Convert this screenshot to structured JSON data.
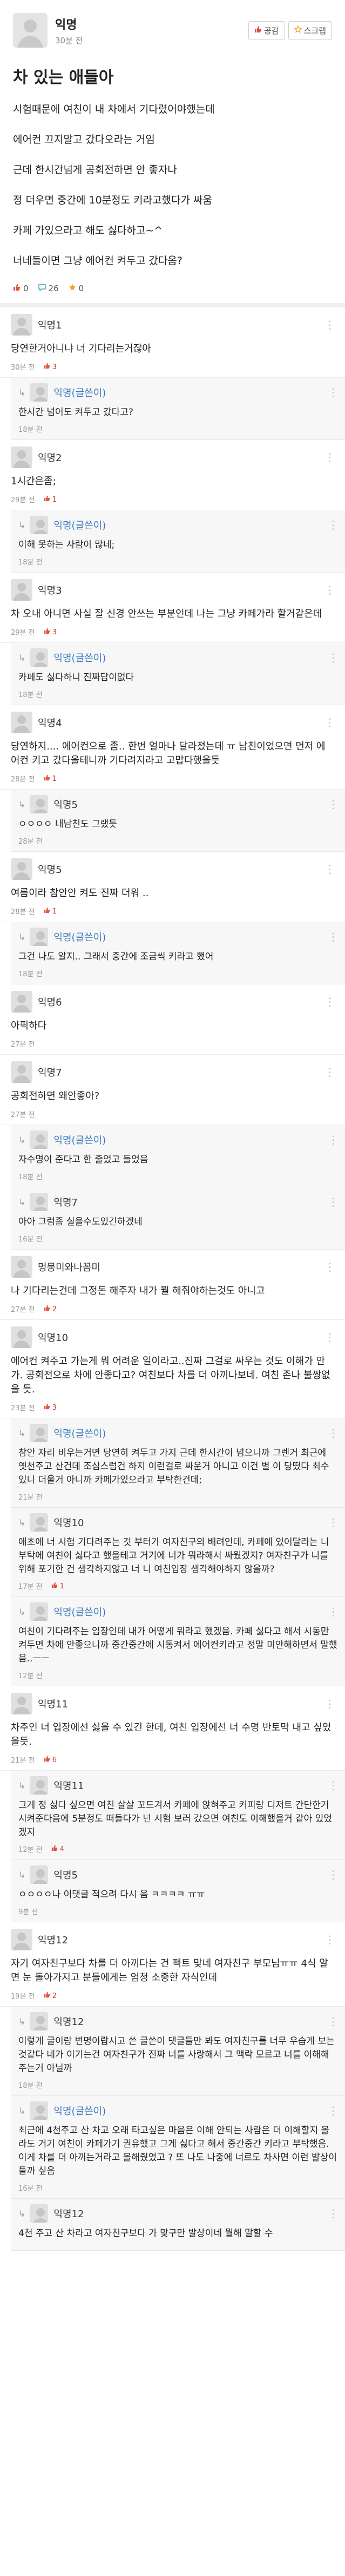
{
  "post": {
    "author": "익명",
    "time": "30분 전",
    "like_label": "공감",
    "scrap_label": "스크랩",
    "title": "차 있는 애들아",
    "paragraphs": [
      "시험때문에 여친이 내 차에서 기다렸어야했는데",
      "에어컨 끄지말고 갔다오라는 거임",
      "근데 한시간넘게 공회전하면 안 좋자나",
      "정 더우면 중간에 10분정도 키라고했다가 싸움",
      "카페 가있으라고 해도 싫다하고~^",
      "너네들이면 그냥 에어컨 켜두고 갔다옴?"
    ],
    "likes": "0",
    "comments": "26",
    "scraps": "0"
  },
  "comments": [
    {
      "type": "comment",
      "name": "익명1",
      "text": "당연한거아니냐 너 기다리는거잖아",
      "time": "30분 전",
      "likes": "3"
    },
    {
      "type": "reply",
      "name": "익명(글쓴이)",
      "text": "한시간 넘어도 켜두고 갔다고?",
      "time": "18분 전",
      "likes": ""
    },
    {
      "type": "comment",
      "name": "익명2",
      "text": "1시간은좀;",
      "time": "29분 전",
      "likes": "1"
    },
    {
      "type": "reply",
      "name": "익명(글쓴이)",
      "text": "이해 못하는 사람이 많네;",
      "time": "18분 전",
      "likes": ""
    },
    {
      "type": "comment",
      "name": "익명3",
      "text": "차 오내 아니면 사실 잘 신경 안쓰는 부분인데 나는 그냥 카페가라 할거같은데",
      "time": "29분 전",
      "likes": "3"
    },
    {
      "type": "reply",
      "name": "익명(글쓴이)",
      "text": "카페도 싫다하니 진짜답이없다",
      "time": "18분 전",
      "likes": ""
    },
    {
      "type": "comment",
      "name": "익명4",
      "text": "당연하지.... 에어컨으로 좀.. 한번 얼마나 달라졌는데 ㅠ 남친이었으면 먼저 에어컨 키고 갔다올테니까 기다려지라고 고맙다했을듯",
      "time": "28분 전",
      "likes": "1"
    },
    {
      "type": "reply",
      "name": "익명5",
      "text": "ㅇㅇㅇㅇ 내남친도 그랬듯",
      "time": "28분 전",
      "likes": ""
    },
    {
      "type": "comment",
      "name": "익명5",
      "text": "여름이라 참안안 켜도 진짜 더워 ..",
      "time": "28분 전",
      "likes": "1"
    },
    {
      "type": "reply",
      "name": "익명(글쓴이)",
      "text": "그건 나도 알지.. 그래서 중간에 조금씩 키라고 했어",
      "time": "18분 전",
      "likes": ""
    },
    {
      "type": "comment",
      "name": "익명6",
      "text": "아픽하다",
      "time": "27분 전",
      "likes": ""
    },
    {
      "type": "comment",
      "name": "익명7",
      "text": "공회전하면 왜안좋아?",
      "time": "27분 전",
      "likes": ""
    },
    {
      "type": "reply",
      "name": "익명(글쓴이)",
      "text": "자수명이 준다고 한 줄었고 들었음",
      "time": "18분 전",
      "likes": ""
    },
    {
      "type": "reply",
      "name": "익명7",
      "text": "아아 그럼좀 실을수도있긴하겠네",
      "time": "16분 전",
      "likes": ""
    },
    {
      "type": "comment",
      "name": "멍뭉미와나꼼미",
      "text": "나 기다리는건데 그정돈 해주자 내가 뭘 해줘야하는것도 아니고",
      "time": "27분 전",
      "likes": "2"
    },
    {
      "type": "comment",
      "name": "익명10",
      "text": "에어컨 켜주고 가는게 뭐 어려운 일이라고..진짜 그걸로 싸우는 것도 이해가 안가. 공회전으로 차에 안좋다고? 여친보다 차를 더 아끼나보네. 여친 존나 불쌍없을 듯.",
      "time": "23분 전",
      "likes": "3"
    },
    {
      "type": "reply",
      "name": "익명(글쓴이)",
      "text": "참안 자리 비우는거면 당연히 켜두고 가지 근데 한시간이 넘으니까 그렌거 최근에 옛천주고 산건데 조심스럽건 하지 이런걸로 싸운거 아니고 이건 별 이 당떴다 최수 있니 더울거 아니까 카페가있으라고 부탁한건데;",
      "time": "21분 전",
      "likes": ""
    },
    {
      "type": "reply",
      "name": "익명10",
      "text": "애초에 너 시험 기다려주는 것 부터가 여자친구의 배려인데, 카페에 있어달라는 니 부탁에 여친이 싫다고 했을테고 거기에 너가 뭐라해서 싸웠겠지? 여자친구가 니를 위해 포기한 건 생각하지않고 너 니 여친입장 생각해야하지 않을까?",
      "time": "17분 전",
      "likes": "1"
    },
    {
      "type": "reply",
      "name": "익명(글쓴이)",
      "text": "여친이 기다려주는 입장인데 내가 어떻게 뭐라고 했겠음. 카페 싫다고 해서 시동만 켜두면 차에 안좋으니까 중간중간에 시동켜서 에어컨키라고 정말 미안해하면서 말했음..ㅡㅡ",
      "time": "12분 전",
      "likes": ""
    },
    {
      "type": "comment",
      "name": "익명11",
      "text": "차주인 너 입장에선 싫을 수 있긴 한데, 여친 입장에선 너 수명 반토막 내고 싶었을듯.",
      "time": "21분 전",
      "likes": "6"
    },
    {
      "type": "reply",
      "name": "익명11",
      "text": "그게 정 싫다 싶으면 여친 살살 꼬드겨서 카페에 앉혀주고 커피랑 디저트 간단한거 시켜준다음에 5분정도 떠들다가 넌 시험 보러 갔으면 여친도 이해했을거 같아 있었겠지",
      "time": "12분 전",
      "likes": "4"
    },
    {
      "type": "reply",
      "name": "익명5",
      "text": "ㅇㅇㅇㅇ나 이댓글 적으려 다시 옴 ㅋㅋㅋㅋ ㅠㅠ",
      "time": "9분 전",
      "likes": ""
    },
    {
      "type": "comment",
      "name": "익명12",
      "text": "자기 여자친구보다 차를 더 아끼다는 건 팩트 맞네 여자친구 부모님ㅠㅠ 4식 알면 눈 돌아가지고 분들에게는 엄청 소중한 자식인데",
      "time": "19분 전",
      "likes": "2"
    },
    {
      "type": "reply",
      "name": "익명12",
      "text": "이렇게 글이랑 변명이랍시고 쓴 글쓴이 댓글들만 봐도 여자친구를 너무 우습게 보는것같다 네가 이기는건 여자친구가 진짜 너를 사랑해서 그 맥락 모르고 너를 이해해주는거 아닐까",
      "time": "18분 전",
      "likes": ""
    },
    {
      "type": "reply",
      "name": "익명(글쓴이)",
      "text": "최근에 4천주고 산 차고 오래 타고싶은 마음은 이해 안되는 사람은 더 이해할지 몰라도 거기 여친이 카페가기 권유했고 그게 싫다고 해서 중간중간 키라고 부탁했음. 이게 차를 더 아끼는거라고 몰해줬었고 ? 또 나도 나중에 너르도 차사면 이런 발상이 들까 싶음",
      "time": "16분 전",
      "likes": ""
    },
    {
      "type": "reply",
      "name": "익명12",
      "text": "4천 주고 산 차라고 여자친구보다 가 맞구만 발상이네 뭘해 말할 수",
      "time": "",
      "likes": ""
    }
  ],
  "icons": {
    "like": "thumb-up-icon",
    "scrap": "star-icon",
    "comment": "comment-icon",
    "more": "more-icon",
    "reply": "reply-arrow-icon"
  },
  "colors": {
    "accent": "#e05040",
    "writer": "#3a78c2"
  }
}
